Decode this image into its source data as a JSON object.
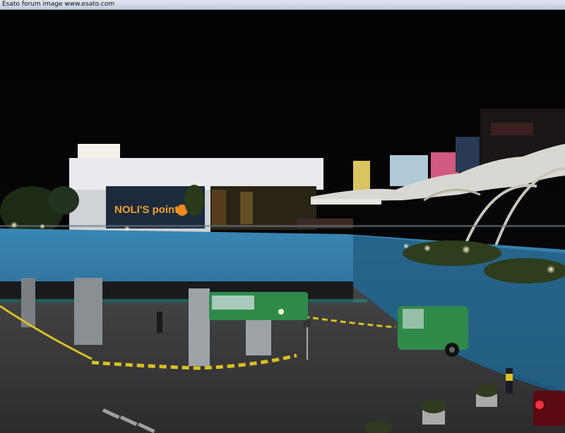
{
  "watermark": {
    "text": "Esato forum image www.esato.com"
  },
  "scene": {
    "store_sign": "NOLI'S point",
    "colors": {
      "sky": "#050505",
      "overpass_blue": "#2a6f9a",
      "overpass_dark": "#1d4f70",
      "canopy": "#d9d7d2",
      "building": "#e8eaee",
      "bus_green": "#2f8a4a",
      "road": "#3a3a3c",
      "lights": "#ffe9a6"
    }
  }
}
